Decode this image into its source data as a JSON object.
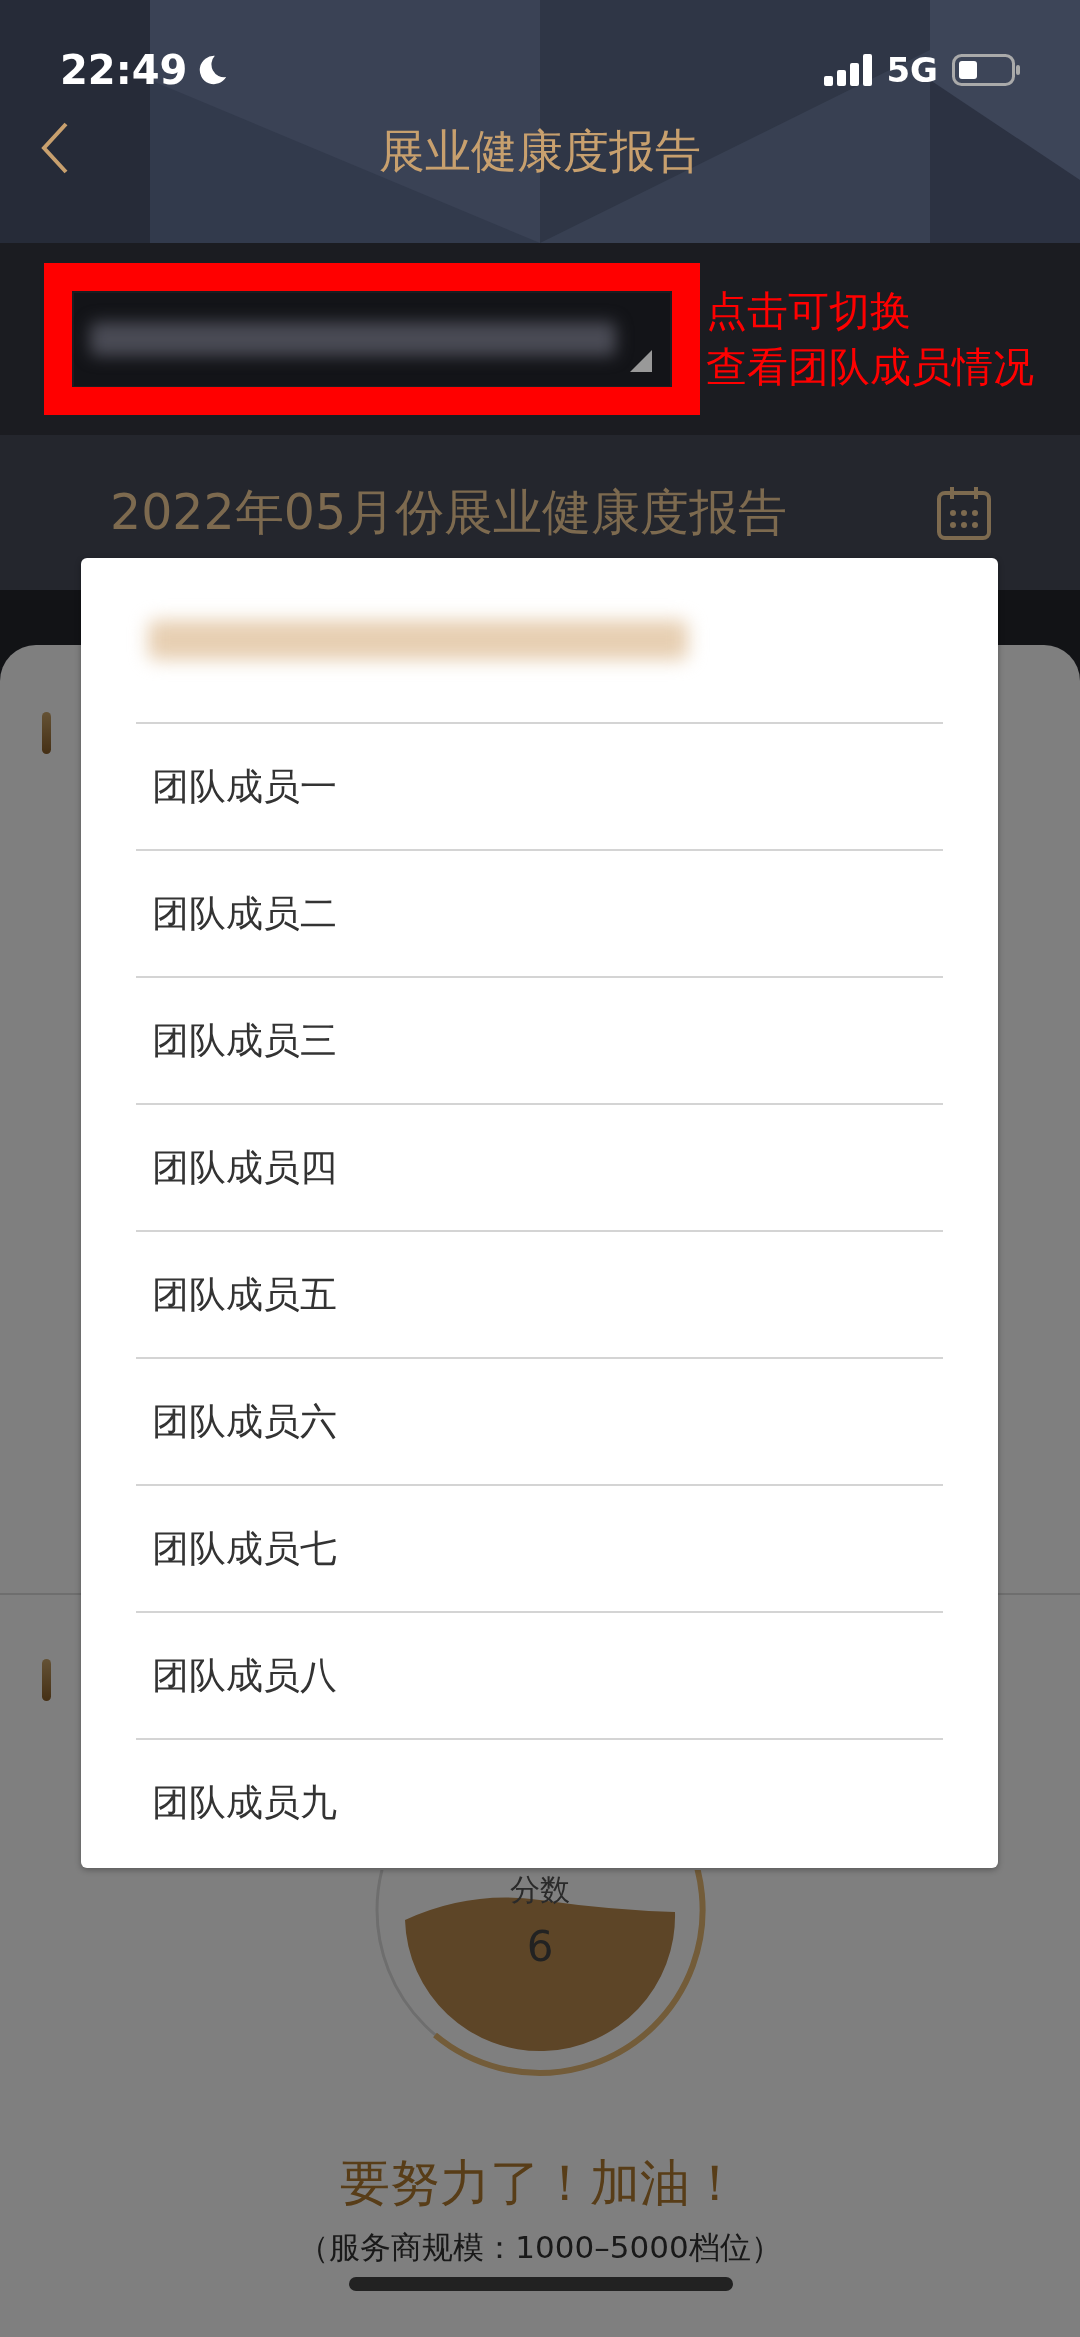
{
  "status_bar": {
    "time": "22:49",
    "network": "5G"
  },
  "nav": {
    "title": "展业健康度报告"
  },
  "annotation": {
    "lines": [
      "点击可切换",
      "查看团队成员情况"
    ]
  },
  "report": {
    "title": "2022年05月份展业健康度报告"
  },
  "score": {
    "label": "分数",
    "value": "6",
    "message": "要努力了！加油！",
    "note": "（服务商规模：1000–5000档位）"
  },
  "dropdown": {
    "options": [
      {
        "label": "团队成员一"
      },
      {
        "label": "团队成员二"
      },
      {
        "label": "团队成员三"
      },
      {
        "label": "团队成员四"
      },
      {
        "label": "团队成员五"
      },
      {
        "label": "团队成员六"
      },
      {
        "label": "团队成员七"
      },
      {
        "label": "团队成员八"
      },
      {
        "label": "团队成员九"
      }
    ]
  }
}
